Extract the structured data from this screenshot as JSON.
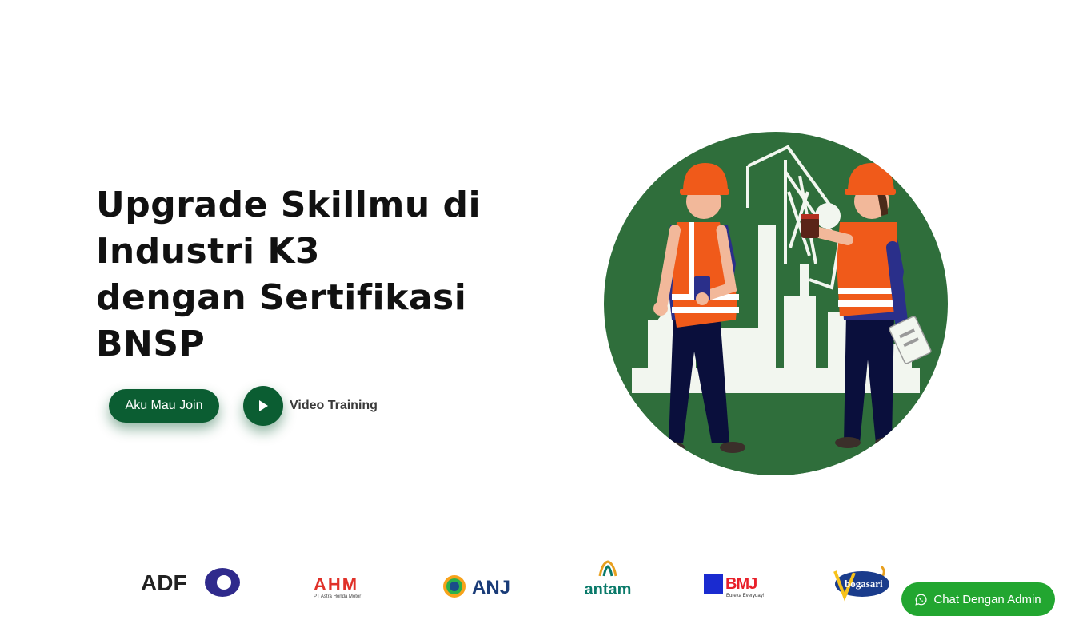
{
  "hero": {
    "title_lines": [
      "Upgrade Skillmu di",
      "Industri K3",
      "dengan Sertifikasi",
      "BNSP"
    ],
    "join_button": "Aku Mau Join",
    "video_label": "Video Training",
    "play_icon": "play-icon"
  },
  "illustration": {
    "icon": "construction-workers-illustration"
  },
  "clients": [
    {
      "name": "ADFO"
    },
    {
      "name": "AHM",
      "tagline": "PT Astra Honda Motor"
    },
    {
      "name": "ANJ"
    },
    {
      "name": "antam"
    },
    {
      "name": "BMJ",
      "tagline": "Eureka Everyday!"
    },
    {
      "name": "bogasari"
    }
  ],
  "chat": {
    "label": "Chat Dengan Admin",
    "icon": "whatsapp-icon"
  },
  "colors": {
    "brand_green": "#0b5d32",
    "illustration_green": "#2f6e3b",
    "vest_orange": "#f05a1a",
    "chat_green": "#22a630",
    "title_text": "#111111"
  }
}
